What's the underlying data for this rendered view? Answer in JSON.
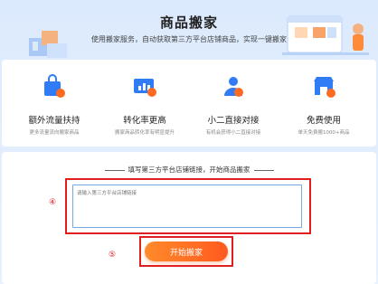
{
  "banner": {
    "title": "商品搬家",
    "subtitle": "使用搬家服务，自动获取第三方平台店铺商品，实现一键搬家"
  },
  "features": [
    {
      "title": "额外流量扶持",
      "desc": "更多流量流向搬家商品",
      "icon": "shopping-bag-icon"
    },
    {
      "title": "转化率更高",
      "desc": "搬家商品转化率有明显提升",
      "icon": "chart-screen-icon"
    },
    {
      "title": "小二直接对接",
      "desc": "有机会获得小二直接对接",
      "icon": "person-badge-icon"
    },
    {
      "title": "免费使用",
      "desc": "单天免费搬1000+商品",
      "icon": "store-icon"
    }
  ],
  "form": {
    "section_title": "填写第三方平台店铺链接，开始商品搬家",
    "placeholder": "请输入第三方平台店铺链接",
    "marker_4": "④",
    "marker_5": "⑤",
    "button_label": "开始搬家"
  },
  "colors": {
    "accent": "#ff6a22",
    "highlight": "#e02020",
    "input_border": "#7aa7e0"
  }
}
